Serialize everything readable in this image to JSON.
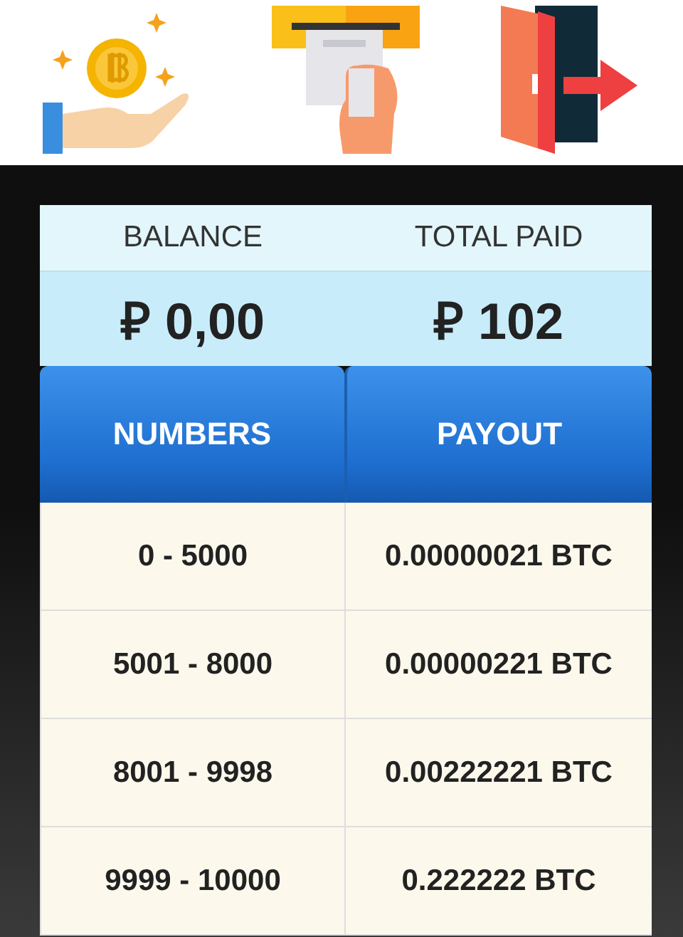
{
  "stats": [
    {
      "label": "BALANCE",
      "value": "₽ 0,00"
    },
    {
      "label": "TOTAL PAID",
      "value": "₽ 102"
    }
  ],
  "table": {
    "columns": [
      "NUMBERS",
      "PAYOUT"
    ],
    "rows": [
      [
        "0 - 5000",
        "0.00000021 BTC"
      ],
      [
        "5001 - 8000",
        "0.00000221 BTC"
      ],
      [
        "8001 - 9998",
        "0.00222221 BTC"
      ],
      [
        "9999 - 10000",
        "0.222222 BTC"
      ]
    ]
  }
}
